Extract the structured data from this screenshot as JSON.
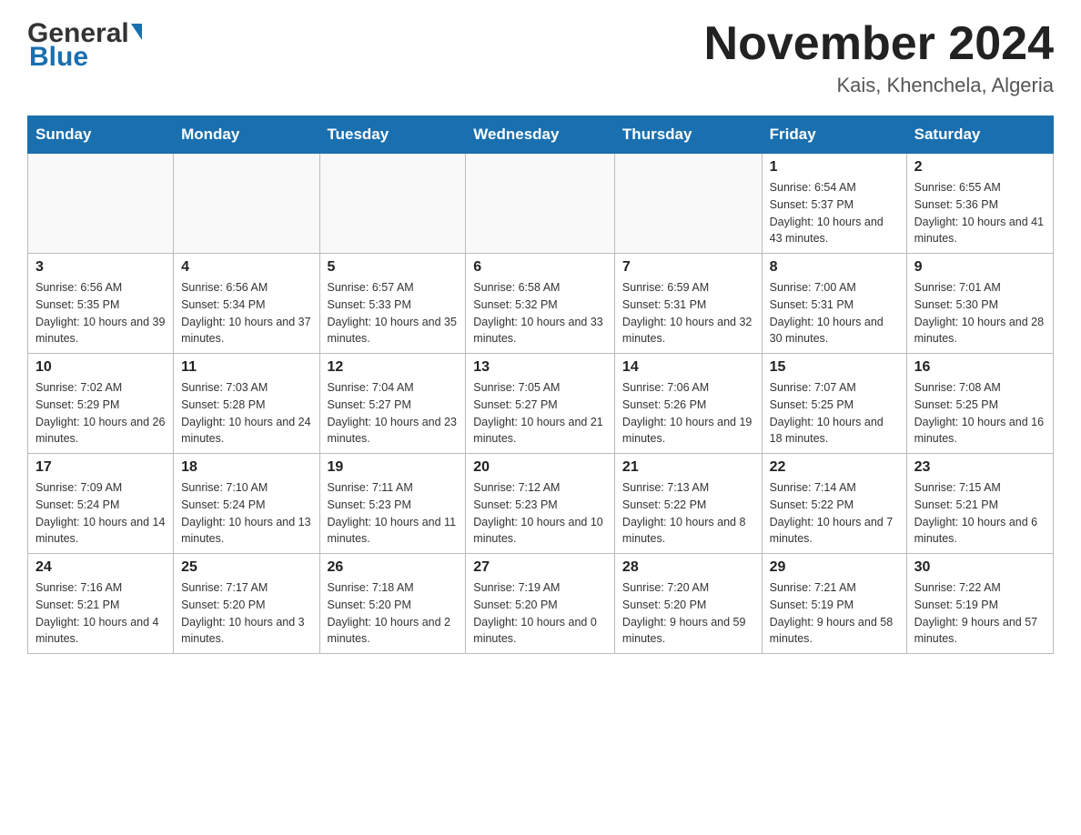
{
  "header": {
    "logo_general": "General",
    "logo_blue": "Blue",
    "month_year": "November 2024",
    "location": "Kais, Khenchela, Algeria"
  },
  "days_of_week": [
    "Sunday",
    "Monday",
    "Tuesday",
    "Wednesday",
    "Thursday",
    "Friday",
    "Saturday"
  ],
  "weeks": [
    [
      {
        "day": "",
        "info": ""
      },
      {
        "day": "",
        "info": ""
      },
      {
        "day": "",
        "info": ""
      },
      {
        "day": "",
        "info": ""
      },
      {
        "day": "",
        "info": ""
      },
      {
        "day": "1",
        "info": "Sunrise: 6:54 AM\nSunset: 5:37 PM\nDaylight: 10 hours and 43 minutes."
      },
      {
        "day": "2",
        "info": "Sunrise: 6:55 AM\nSunset: 5:36 PM\nDaylight: 10 hours and 41 minutes."
      }
    ],
    [
      {
        "day": "3",
        "info": "Sunrise: 6:56 AM\nSunset: 5:35 PM\nDaylight: 10 hours and 39 minutes."
      },
      {
        "day": "4",
        "info": "Sunrise: 6:56 AM\nSunset: 5:34 PM\nDaylight: 10 hours and 37 minutes."
      },
      {
        "day": "5",
        "info": "Sunrise: 6:57 AM\nSunset: 5:33 PM\nDaylight: 10 hours and 35 minutes."
      },
      {
        "day": "6",
        "info": "Sunrise: 6:58 AM\nSunset: 5:32 PM\nDaylight: 10 hours and 33 minutes."
      },
      {
        "day": "7",
        "info": "Sunrise: 6:59 AM\nSunset: 5:31 PM\nDaylight: 10 hours and 32 minutes."
      },
      {
        "day": "8",
        "info": "Sunrise: 7:00 AM\nSunset: 5:31 PM\nDaylight: 10 hours and 30 minutes."
      },
      {
        "day": "9",
        "info": "Sunrise: 7:01 AM\nSunset: 5:30 PM\nDaylight: 10 hours and 28 minutes."
      }
    ],
    [
      {
        "day": "10",
        "info": "Sunrise: 7:02 AM\nSunset: 5:29 PM\nDaylight: 10 hours and 26 minutes."
      },
      {
        "day": "11",
        "info": "Sunrise: 7:03 AM\nSunset: 5:28 PM\nDaylight: 10 hours and 24 minutes."
      },
      {
        "day": "12",
        "info": "Sunrise: 7:04 AM\nSunset: 5:27 PM\nDaylight: 10 hours and 23 minutes."
      },
      {
        "day": "13",
        "info": "Sunrise: 7:05 AM\nSunset: 5:27 PM\nDaylight: 10 hours and 21 minutes."
      },
      {
        "day": "14",
        "info": "Sunrise: 7:06 AM\nSunset: 5:26 PM\nDaylight: 10 hours and 19 minutes."
      },
      {
        "day": "15",
        "info": "Sunrise: 7:07 AM\nSunset: 5:25 PM\nDaylight: 10 hours and 18 minutes."
      },
      {
        "day": "16",
        "info": "Sunrise: 7:08 AM\nSunset: 5:25 PM\nDaylight: 10 hours and 16 minutes."
      }
    ],
    [
      {
        "day": "17",
        "info": "Sunrise: 7:09 AM\nSunset: 5:24 PM\nDaylight: 10 hours and 14 minutes."
      },
      {
        "day": "18",
        "info": "Sunrise: 7:10 AM\nSunset: 5:24 PM\nDaylight: 10 hours and 13 minutes."
      },
      {
        "day": "19",
        "info": "Sunrise: 7:11 AM\nSunset: 5:23 PM\nDaylight: 10 hours and 11 minutes."
      },
      {
        "day": "20",
        "info": "Sunrise: 7:12 AM\nSunset: 5:23 PM\nDaylight: 10 hours and 10 minutes."
      },
      {
        "day": "21",
        "info": "Sunrise: 7:13 AM\nSunset: 5:22 PM\nDaylight: 10 hours and 8 minutes."
      },
      {
        "day": "22",
        "info": "Sunrise: 7:14 AM\nSunset: 5:22 PM\nDaylight: 10 hours and 7 minutes."
      },
      {
        "day": "23",
        "info": "Sunrise: 7:15 AM\nSunset: 5:21 PM\nDaylight: 10 hours and 6 minutes."
      }
    ],
    [
      {
        "day": "24",
        "info": "Sunrise: 7:16 AM\nSunset: 5:21 PM\nDaylight: 10 hours and 4 minutes."
      },
      {
        "day": "25",
        "info": "Sunrise: 7:17 AM\nSunset: 5:20 PM\nDaylight: 10 hours and 3 minutes."
      },
      {
        "day": "26",
        "info": "Sunrise: 7:18 AM\nSunset: 5:20 PM\nDaylight: 10 hours and 2 minutes."
      },
      {
        "day": "27",
        "info": "Sunrise: 7:19 AM\nSunset: 5:20 PM\nDaylight: 10 hours and 0 minutes."
      },
      {
        "day": "28",
        "info": "Sunrise: 7:20 AM\nSunset: 5:20 PM\nDaylight: 9 hours and 59 minutes."
      },
      {
        "day": "29",
        "info": "Sunrise: 7:21 AM\nSunset: 5:19 PM\nDaylight: 9 hours and 58 minutes."
      },
      {
        "day": "30",
        "info": "Sunrise: 7:22 AM\nSunset: 5:19 PM\nDaylight: 9 hours and 57 minutes."
      }
    ]
  ]
}
